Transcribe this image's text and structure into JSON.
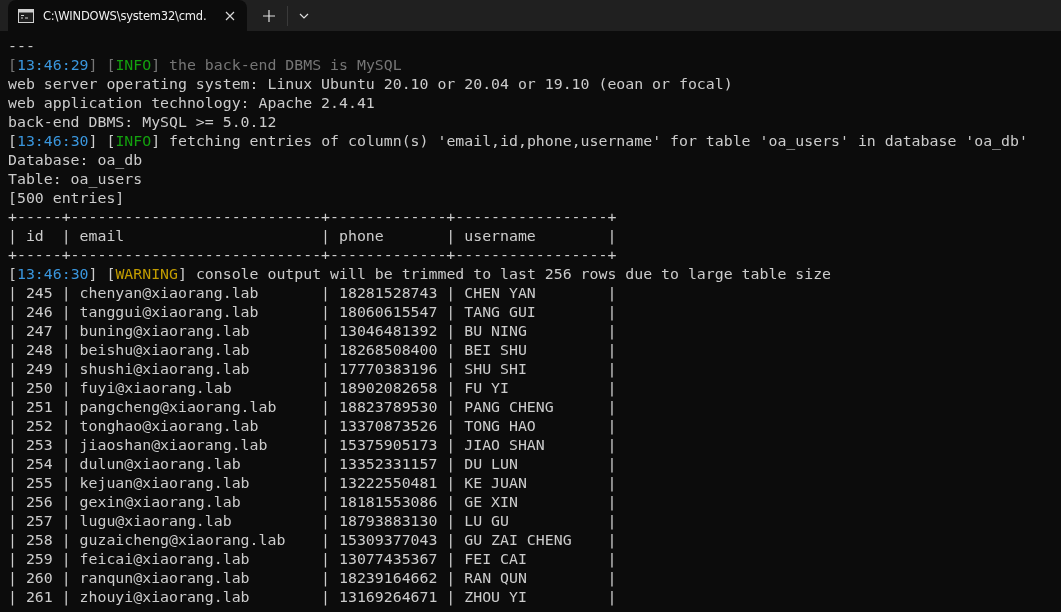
{
  "tabs": [
    {
      "title": "C:\\WINDOWS\\system32\\cmd.",
      "selected": true
    }
  ],
  "lines": [
    {
      "kind": "plain",
      "text": "---"
    },
    {
      "kind": "segments",
      "segments": [
        {
          "text": "[",
          "kind": "dim"
        },
        {
          "text": "13:46:29",
          "kind": "time"
        },
        {
          "text": "] [",
          "kind": "dim"
        },
        {
          "text": "INFO",
          "kind": "info"
        },
        {
          "text": "] the back-end DBMS is MySQL",
          "kind": "dim"
        }
      ]
    },
    {
      "kind": "plain",
      "text": "web server operating system: Linux Ubuntu 20.10 or 20.04 or 19.10 (eoan or focal)"
    },
    {
      "kind": "plain",
      "text": "web application technology: Apache 2.4.41"
    },
    {
      "kind": "plain",
      "text": "back-end DBMS: MySQL >= 5.0.12"
    },
    {
      "kind": "segments",
      "segments": [
        {
          "text": "[",
          "kind": "plain"
        },
        {
          "text": "13:46:30",
          "kind": "time"
        },
        {
          "text": "] [",
          "kind": "plain"
        },
        {
          "text": "INFO",
          "kind": "info"
        },
        {
          "text": "] fetching entries of column(s) 'email,id,phone,username' for table 'oa_users' in database 'oa_db'",
          "kind": "plain"
        }
      ]
    },
    {
      "kind": "plain",
      "text": "Database: oa_db"
    },
    {
      "kind": "plain",
      "text": "Table: oa_users"
    },
    {
      "kind": "plain",
      "text": "[500 entries]"
    },
    {
      "kind": "border",
      "text": "+-----+----------------------------+-------------+-----------------+"
    },
    {
      "kind": "header",
      "text": "| id  | email                      | phone       | username        |"
    },
    {
      "kind": "border",
      "text": "+-----+----------------------------+-------------+-----------------+"
    },
    {
      "kind": "segments",
      "segments": [
        {
          "text": "[",
          "kind": "plain"
        },
        {
          "text": "13:46:30",
          "kind": "time"
        },
        {
          "text": "] [",
          "kind": "plain"
        },
        {
          "text": "WARNING",
          "kind": "warning"
        },
        {
          "text": "] console output will be trimmed to last 256 rows due to large table size",
          "kind": "plain"
        }
      ]
    },
    {
      "kind": "row",
      "text": "| 245 | chenyan@xiaorang.lab       | 18281528743 | CHEN YAN        |"
    },
    {
      "kind": "row",
      "text": "| 246 | tanggui@xiaorang.lab       | 18060615547 | TANG GUI        |"
    },
    {
      "kind": "row",
      "text": "| 247 | buning@xiaorang.lab        | 13046481392 | BU NING         |"
    },
    {
      "kind": "row",
      "text": "| 248 | beishu@xiaorang.lab        | 18268508400 | BEI SHU         |"
    },
    {
      "kind": "row",
      "text": "| 249 | shushi@xiaorang.lab        | 17770383196 | SHU SHI         |"
    },
    {
      "kind": "row",
      "text": "| 250 | fuyi@xiaorang.lab          | 18902082658 | FU YI           |"
    },
    {
      "kind": "row",
      "text": "| 251 | pangcheng@xiaorang.lab     | 18823789530 | PANG CHENG      |"
    },
    {
      "kind": "row",
      "text": "| 252 | tonghao@xiaorang.lab       | 13370873526 | TONG HAO        |"
    },
    {
      "kind": "row",
      "text": "| 253 | jiaoshan@xiaorang.lab      | 15375905173 | JIAO SHAN       |"
    },
    {
      "kind": "row",
      "text": "| 254 | dulun@xiaorang.lab         | 13352331157 | DU LUN          |"
    },
    {
      "kind": "row",
      "text": "| 255 | kejuan@xiaorang.lab        | 13222550481 | KE JUAN         |"
    },
    {
      "kind": "row",
      "text": "| 256 | gexin@xiaorang.lab         | 18181553086 | GE XIN          |"
    },
    {
      "kind": "row",
      "text": "| 257 | lugu@xiaorang.lab          | 18793883130 | LU GU           |"
    },
    {
      "kind": "row",
      "text": "| 258 | guzaicheng@xiaorang.lab    | 15309377043 | GU ZAI CHENG    |"
    },
    {
      "kind": "row",
      "text": "| 259 | feicai@xiaorang.lab        | 13077435367 | FEI CAI         |"
    },
    {
      "kind": "row",
      "text": "| 260 | ranqun@xiaorang.lab        | 18239164662 | RAN QUN         |"
    },
    {
      "kind": "row",
      "text": "| 261 | zhouyi@xiaorang.lab        | 13169264671 | ZHOU YI         |"
    }
  ]
}
